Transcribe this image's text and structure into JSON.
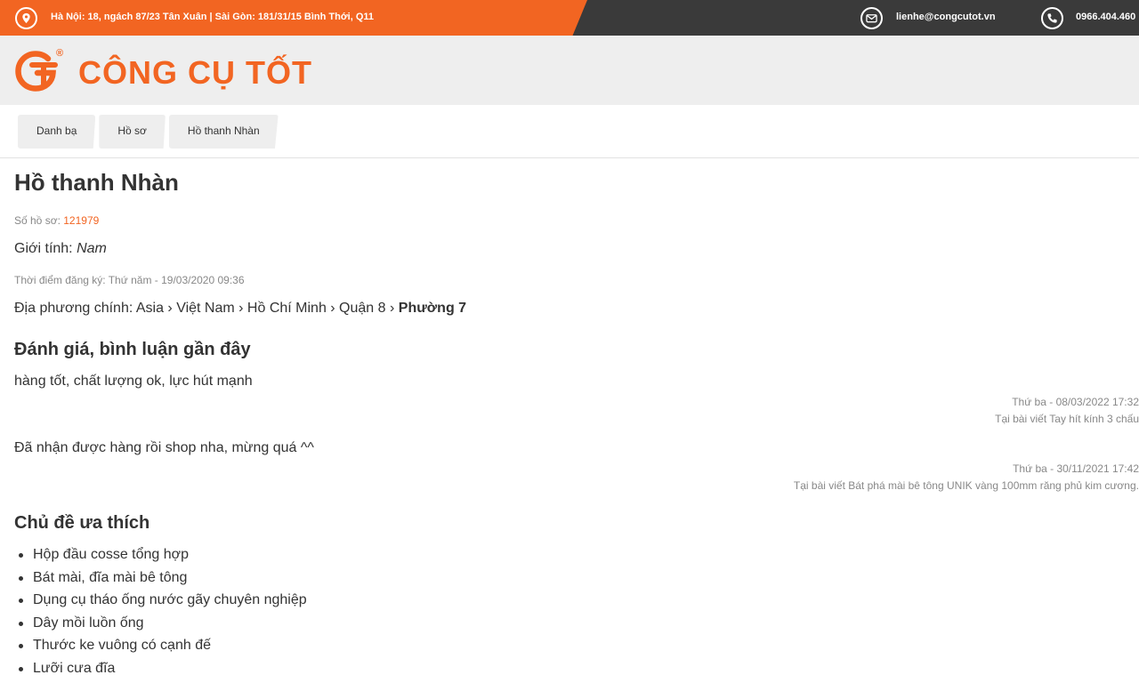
{
  "topbar": {
    "address": "Hà Nội: 18, ngách 87/23 Tân Xuân | Sài Gòn: 181/31/15 Bình Thới, Q11",
    "email": "lienhe@congcutot.vn",
    "phone": "0966.404.460",
    "icons": [
      "map-pin-icon",
      "mail-icon",
      "phone-icon"
    ],
    "colors": {
      "orange": "#f26522",
      "dark": "#3a3a3a"
    }
  },
  "header": {
    "logo_text": "CÔNG CỤ TỐT",
    "registered_mark": "®",
    "logo_color": "#f26522"
  },
  "breadcrumb": [
    "Danh bạ",
    "Hồ sơ",
    "Hồ thanh Nhàn"
  ],
  "profile": {
    "name": "Hồ thanh Nhàn",
    "profile_number_label": "Số hồ sơ:",
    "profile_number": "121979",
    "gender_label": "Giới tính:",
    "gender": "Nam",
    "registered_label": "Thời điểm đăng ký:",
    "registered_at": "Thứ năm - 19/03/2020 09:36",
    "location_label": "Địa phương chính:",
    "location_path": "Asia › Việt Nam › Hồ Chí Minh › Quận 8 ›",
    "location_last": "Phường 7"
  },
  "reviews": {
    "title": "Đánh giá, bình luận gần đây",
    "items": [
      {
        "text": "hàng tốt, chất lượng ok, lực hút mạnh",
        "date": "Thứ ba - 08/03/2022 17:32",
        "post": "Tại bài viết Tay hít kính 3 chấu"
      },
      {
        "text": "Đã nhận được hàng rồi shop nha, mừng quá ^^",
        "date": "Thứ ba - 30/11/2021 17:42",
        "post": "Tại bài viết Bát phá mài bê tông UNIK vàng 100mm răng phủ kim cương."
      }
    ]
  },
  "topics": {
    "title": "Chủ đề ưa thích",
    "items": [
      "Hộp đầu cosse tổng hợp",
      "Bát mài, đĩa mài bê tông",
      "Dụng cụ tháo ống nước gãy chuyên nghiệp",
      "Dây mồi luồn ống",
      "Thước ke vuông có cạnh đế",
      "Lưỡi cưa đĩa"
    ]
  }
}
